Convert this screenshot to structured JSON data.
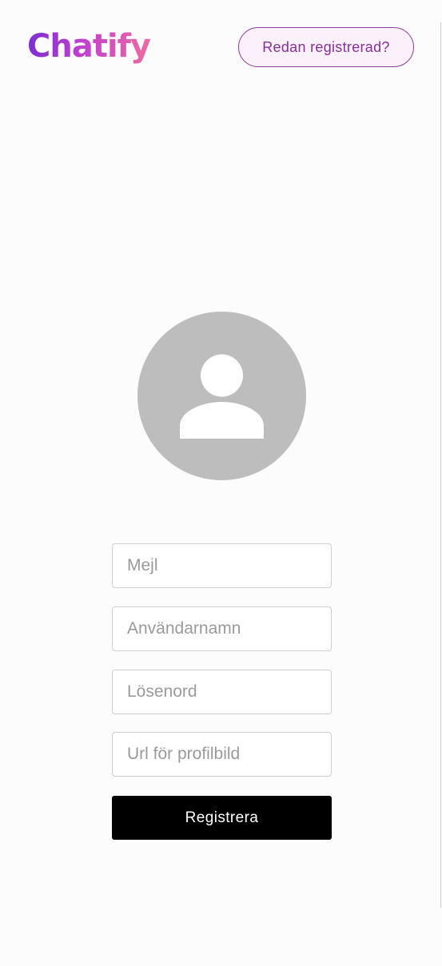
{
  "header": {
    "logo_text": "Chatify",
    "login_link_label": "Redan registrerad?"
  },
  "avatar": {
    "icon": "person-icon"
  },
  "form": {
    "email_placeholder": "Mejl",
    "username_placeholder": "Användarnamn",
    "password_placeholder": "Lösenord",
    "avatar_url_placeholder": "Url för profilbild",
    "submit_label": "Registrera"
  },
  "colors": {
    "accent": "#8e3a9d",
    "button_bg": "#000000",
    "avatar_bg": "#bdbdbd"
  }
}
